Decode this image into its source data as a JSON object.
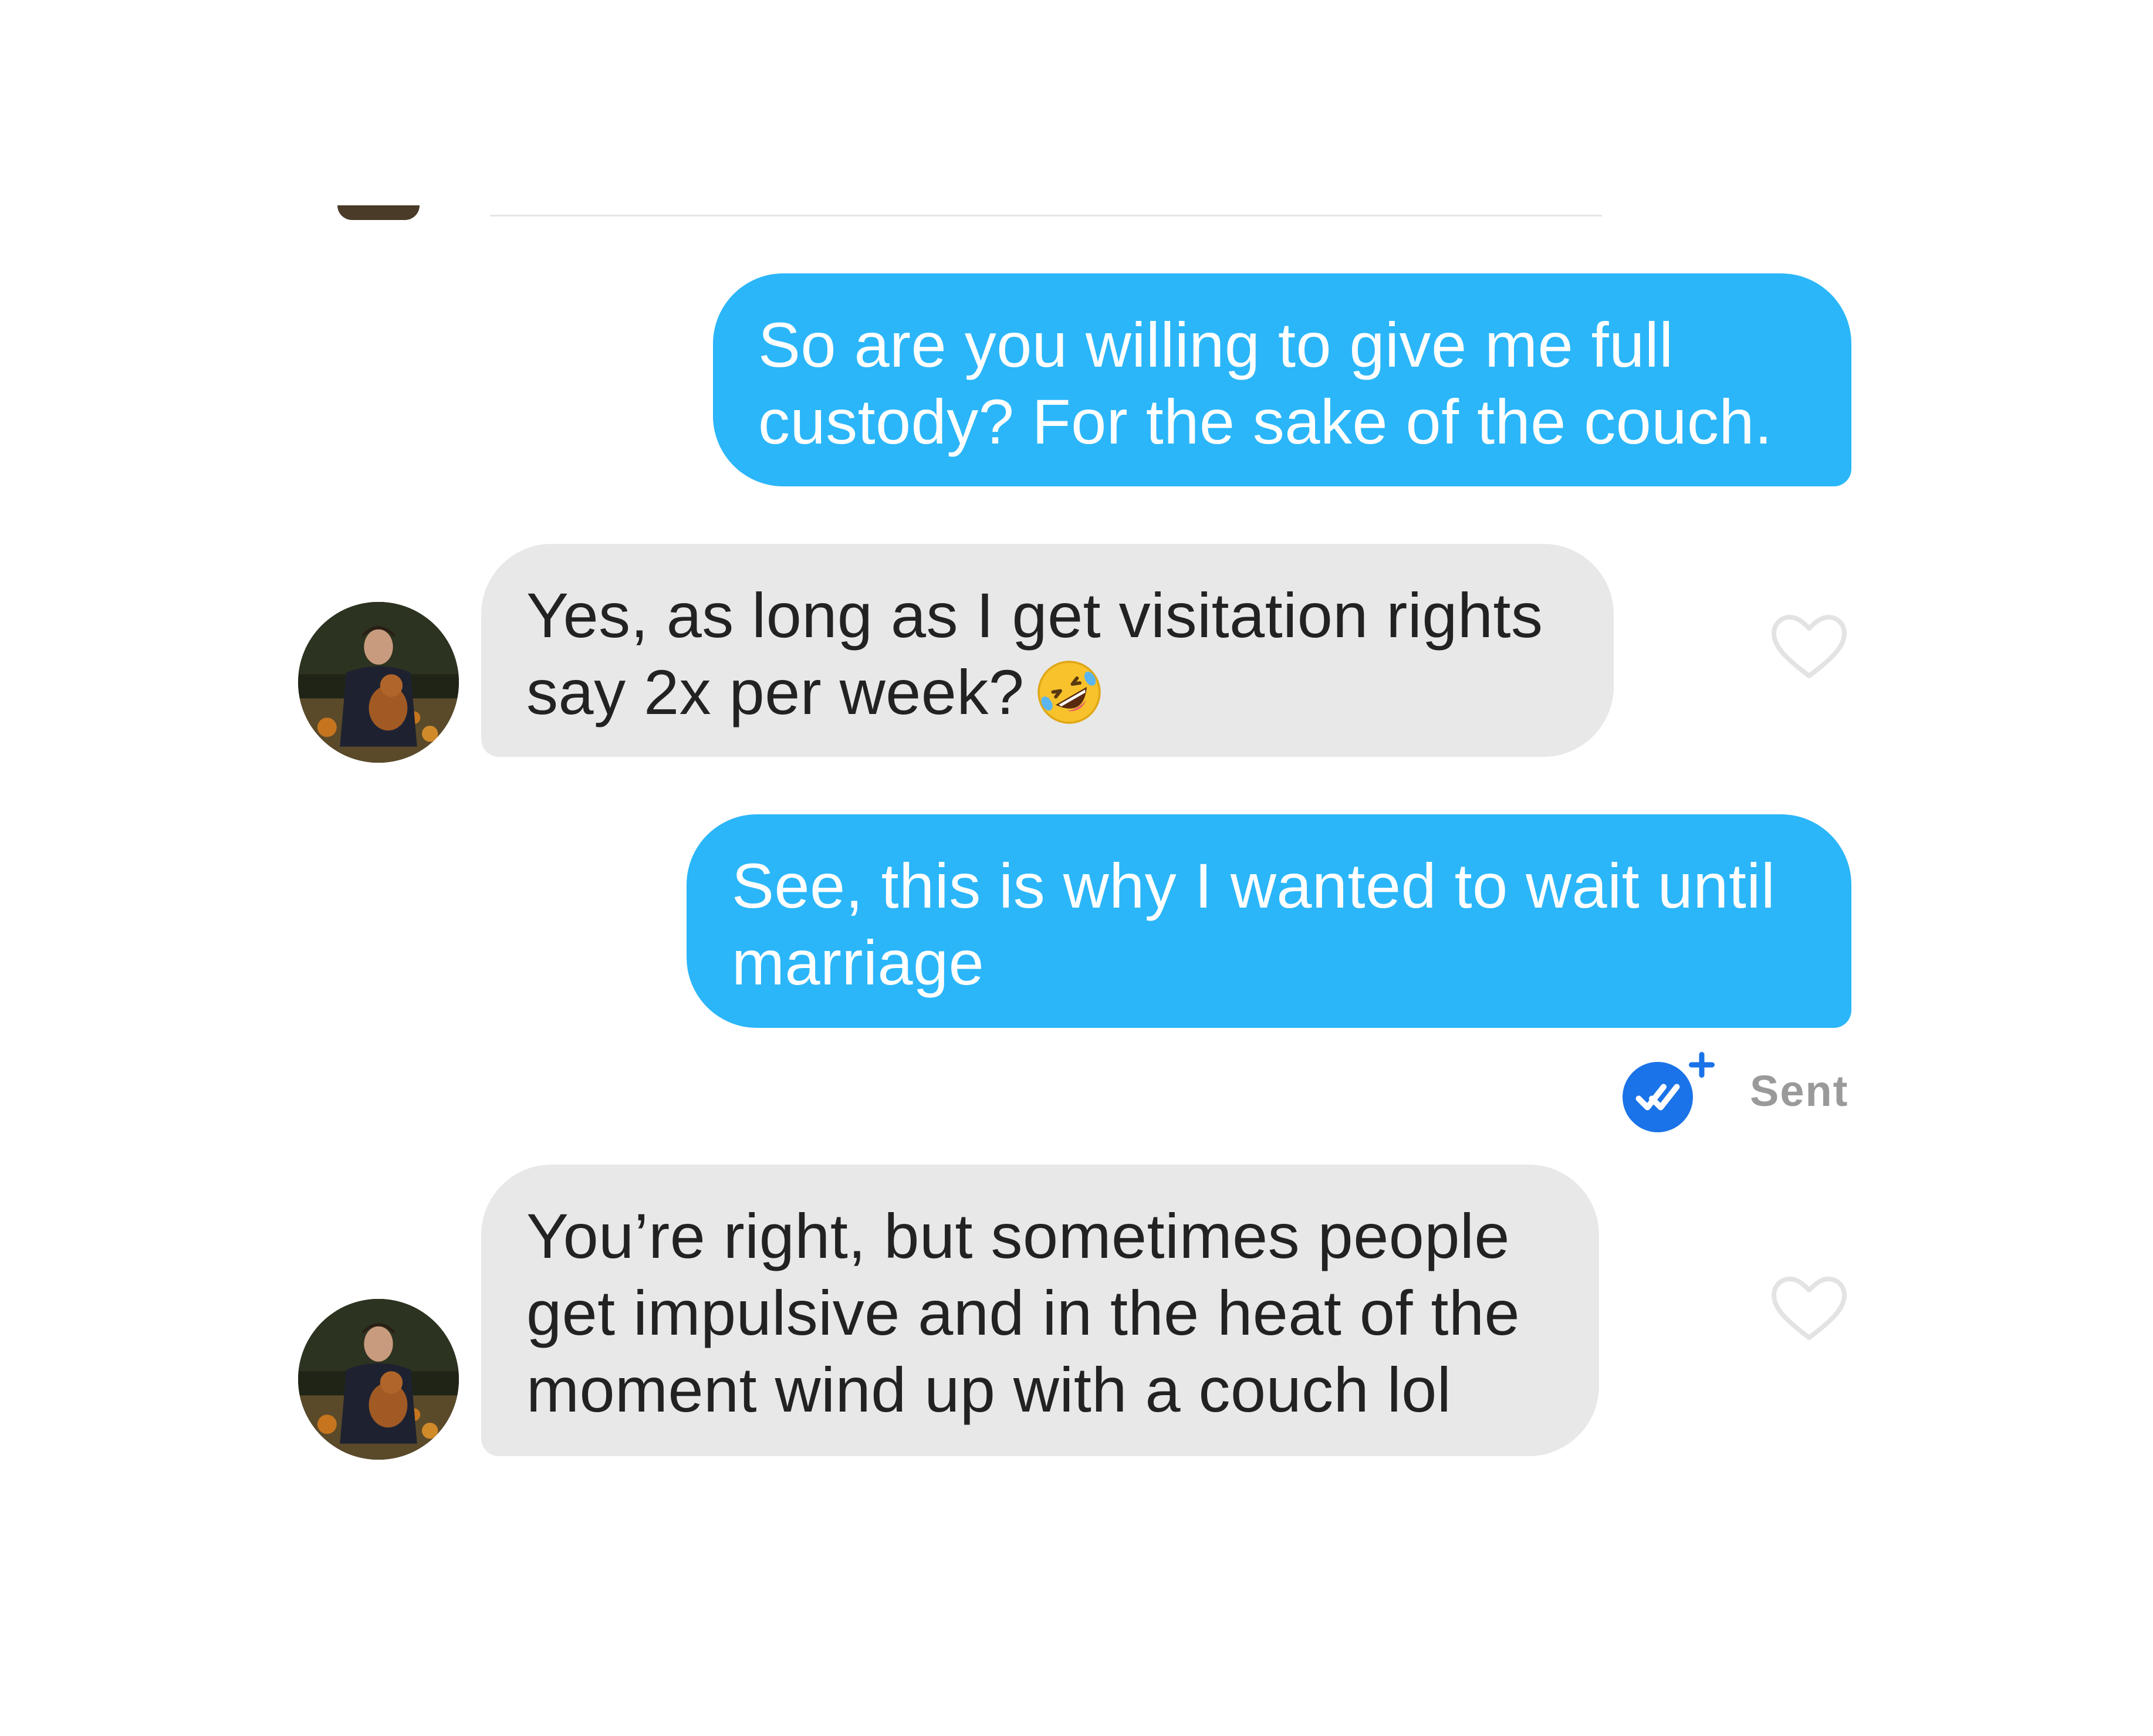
{
  "colors": {
    "outgoing_bubble": "#2bb6f9",
    "incoming_bubble": "#e8e8e8",
    "read_receipt": "#1a73e8",
    "sent_label": "#9a9a9a"
  },
  "messages": [
    {
      "direction": "outgoing",
      "lines": [
        "So are you willing to give me full",
        "custody? For the sake of the couch."
      ]
    },
    {
      "direction": "incoming",
      "lines": [
        "Yes, as long as I get visitation rights",
        "say 2x per week?"
      ],
      "emoji": "rolling-on-floor-laughing-emoji",
      "liked": false
    },
    {
      "direction": "outgoing",
      "lines": [
        "See, this is why I wanted to wait until",
        "marriage"
      ],
      "status": "Sent",
      "status_icon": "read-receipt-plus-icon"
    },
    {
      "direction": "incoming",
      "lines": [
        "You’re right, but sometimes people",
        "get impulsive and in the heat of the",
        "moment wind up with a couch lol"
      ],
      "liked": false
    }
  ]
}
